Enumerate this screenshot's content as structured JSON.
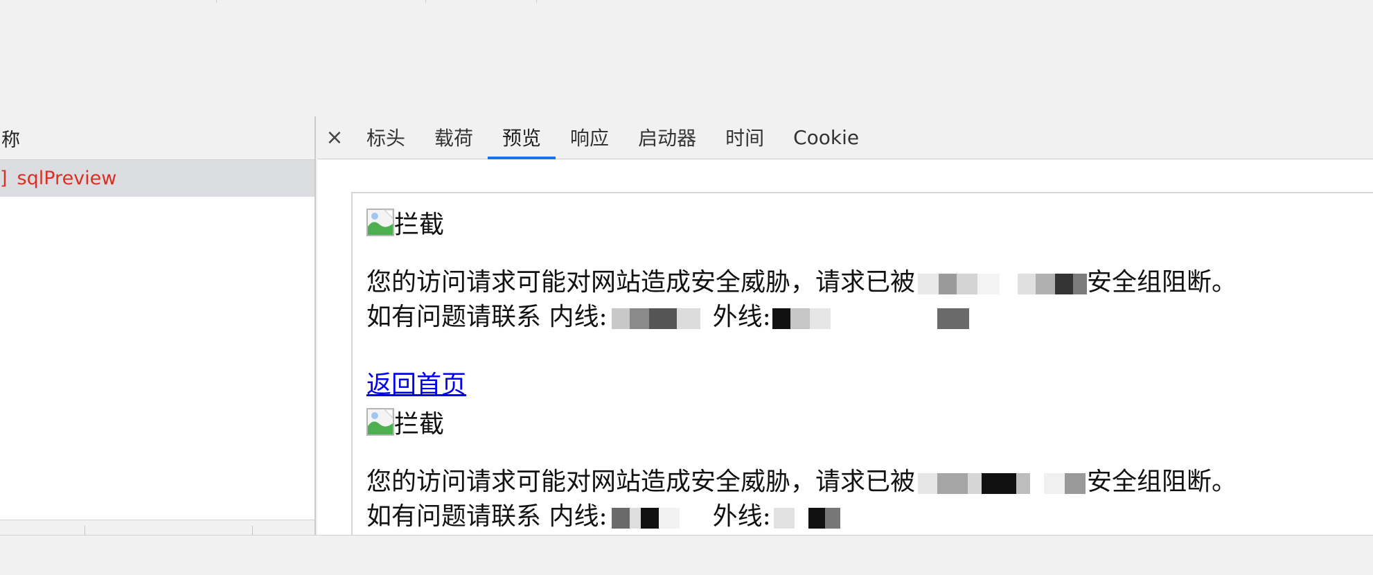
{
  "network_list": {
    "column_header": "称",
    "request": {
      "bracket": "]",
      "name": "sqlPreview"
    }
  },
  "tabs": {
    "close_glyph": "×",
    "items": [
      "标头",
      "载荷",
      "预览",
      "响应",
      "启动器",
      "时间",
      "Cookie"
    ],
    "active": "预览"
  },
  "preview": {
    "blocks": [
      {
        "img_alt": "拦截",
        "line1_prefix": "您的访问请求可能对网站造成安全威胁，请求已被",
        "line1_suffix": "安全组阻断。",
        "line2_prefix": "如有问题请联系 内线:",
        "line2_mid": "外线:",
        "link": "返回首页"
      },
      {
        "img_alt": "拦截",
        "line1_prefix": "您的访问请求可能对网站造成安全威胁，请求已被",
        "line1_suffix": "安全组阻断。",
        "line2_prefix": "如有问题请联系 内线:",
        "line2_mid": "外线:"
      }
    ]
  },
  "colors": {
    "accent": "#1a73e8",
    "error_request": "#d93025",
    "link": "#0000ee"
  }
}
